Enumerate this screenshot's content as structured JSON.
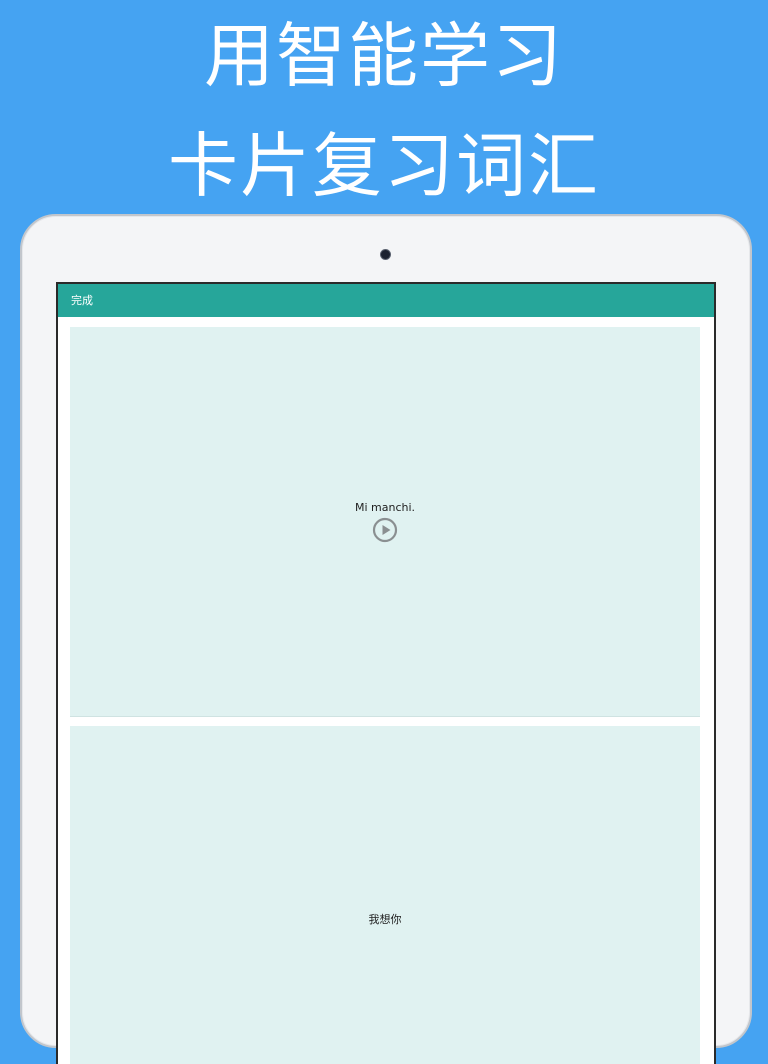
{
  "promo": {
    "line1": "用智能学习",
    "line2": "卡片复习词汇"
  },
  "app_bar": {
    "done_label": "完成"
  },
  "flashcard": {
    "front_text": "Mi manchi.",
    "play_icon": "play-circle-icon",
    "back_text": "我想你"
  },
  "colors": {
    "background": "#45a3f2",
    "app_bar": "#26a69a",
    "card": "#e0f2f1"
  }
}
